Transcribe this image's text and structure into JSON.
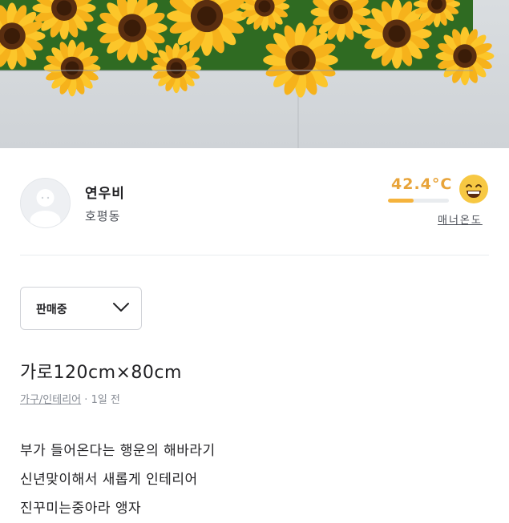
{
  "photo": {
    "alt": "sunflower-curtain-photo"
  },
  "seller": {
    "nickname": "연우비",
    "region": "호평동",
    "temperature": "42.4°C",
    "temperature_percent": 42.4,
    "manner_label": "매너온도"
  },
  "status_select": {
    "selected": "판매중"
  },
  "post": {
    "title": "가로120cm×80cm",
    "category": "가구/인테리어",
    "separator": "·",
    "time": "1일 전",
    "description": [
      "부가 들어온다는 행운의 해바라기",
      "신년맞이해서 새롭게 인테리어",
      "진꾸미는중아라 앵자"
    ]
  },
  "colors": {
    "temperature": "#e8a43a",
    "text": "#212124",
    "muted": "#868b94"
  }
}
